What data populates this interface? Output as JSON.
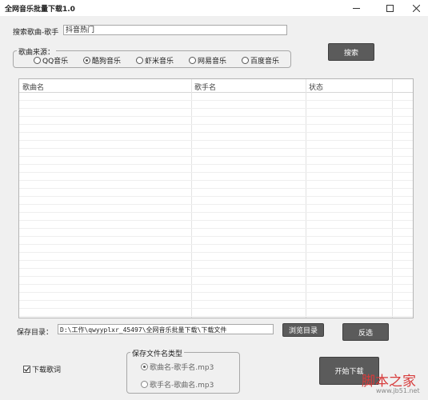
{
  "window": {
    "title": "全网音乐批量下载1.0"
  },
  "search": {
    "label": "搜索歌曲-歌手",
    "value": "抖音热门",
    "button": "搜索"
  },
  "source": {
    "legend": "歌曲来源：",
    "options": [
      {
        "label": "QQ音乐",
        "selected": false
      },
      {
        "label": "酷狗音乐",
        "selected": true
      },
      {
        "label": "虾米音乐",
        "selected": false
      },
      {
        "label": "网易音乐",
        "selected": false
      },
      {
        "label": "百度音乐",
        "selected": false
      }
    ]
  },
  "table": {
    "columns": [
      "歌曲名",
      "歌手名",
      "状态"
    ],
    "rows": []
  },
  "save": {
    "label": "保存目录：",
    "path": "D:\\工作\\qwyyplxr_45497\\全网音乐批量下载\\下载文件",
    "browse_button": "浏览目录",
    "invert_button": "反选"
  },
  "lyrics": {
    "label": "下载歌词",
    "checked": true
  },
  "filename": {
    "legend": "保存文件名类型",
    "options": [
      {
        "label": "歌曲名-歌手名.mp3",
        "selected": true
      },
      {
        "label": "歌手名-歌曲名.mp3",
        "selected": false
      }
    ]
  },
  "start_button": "开始下载",
  "watermark": {
    "text": "脚本之家",
    "url": "www.jb51.net"
  }
}
